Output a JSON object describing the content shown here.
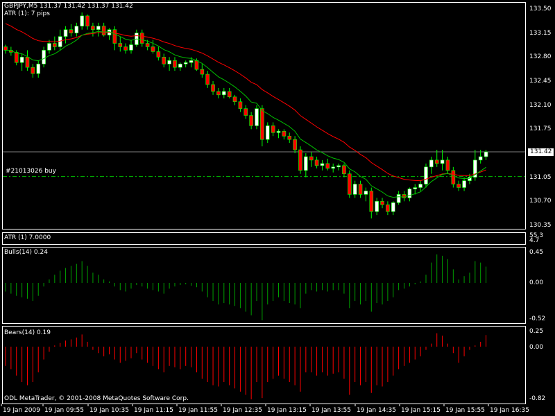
{
  "header": {
    "symbol_line": "GBPJPY,M5  131.37 131.42 131.37 131.42",
    "atr_line": "ATR (1): 7 pips"
  },
  "order": {
    "label": "#21013026 buy",
    "price": 131.06
  },
  "current_price_tag": "131.42",
  "panels": {
    "atr": {
      "label": "ATR (1) 7.0000",
      "axis": [
        "55.3",
        "4.7"
      ]
    },
    "bulls": {
      "label": "Bulls(14) 0.24",
      "axis": [
        "0.45",
        "0.00",
        "-0.52"
      ]
    },
    "bears": {
      "label": "Bears(14) 0.19",
      "axis": [
        "0.25",
        "0.00",
        "-0.82"
      ]
    }
  },
  "price_axis": [
    "133.50",
    "133.15",
    "132.80",
    "132.45",
    "132.10",
    "131.75",
    "131.05",
    "130.70",
    "130.35"
  ],
  "time_axis": [
    "19 Jan 2009",
    "19 Jan 09:55",
    "19 Jan 10:35",
    "19 Jan 11:15",
    "19 Jan 11:55",
    "19 Jan 12:35",
    "19 Jan 13:15",
    "19 Jan 13:55",
    "19 Jan 14:35",
    "19 Jan 15:15",
    "19 Jan 15:55",
    "19 Jan 16:35"
  ],
  "copyright": "ODL MetaTrader, © 2001-2008 MetaQuotes Software Corp.",
  "colors": {
    "bull": "#ffffff",
    "bear": "#ff0000",
    "wick": "#00ff00",
    "ma_slow": "#ff0000",
    "ma_fast": "#00c000",
    "bulls": "#00a000",
    "bears": "#ff0000",
    "grid_line": "#808080"
  },
  "chart_data": {
    "type": "candlestick",
    "price_range": [
      130.35,
      133.6
    ],
    "candles": [
      [
        132.95,
        132.98,
        132.85,
        132.9
      ],
      [
        132.9,
        132.95,
        132.82,
        132.87
      ],
      [
        132.87,
        132.9,
        132.68,
        132.72
      ],
      [
        132.72,
        132.85,
        132.6,
        132.8
      ],
      [
        132.8,
        132.9,
        132.6,
        132.65
      ],
      [
        132.65,
        132.7,
        132.5,
        132.56
      ],
      [
        132.56,
        132.75,
        132.5,
        132.7
      ],
      [
        132.7,
        132.95,
        132.65,
        132.9
      ],
      [
        132.9,
        133.05,
        132.85,
        133.0
      ],
      [
        133.0,
        133.1,
        132.9,
        132.95
      ],
      [
        132.95,
        133.2,
        132.9,
        133.1
      ],
      [
        133.1,
        133.25,
        133.0,
        133.2
      ],
      [
        133.2,
        133.28,
        133.1,
        133.15
      ],
      [
        133.15,
        133.3,
        133.1,
        133.25
      ],
      [
        133.25,
        133.45,
        133.2,
        133.4
      ],
      [
        133.4,
        133.42,
        133.2,
        133.25
      ],
      [
        133.25,
        133.3,
        133.1,
        133.2
      ],
      [
        133.2,
        133.3,
        133.1,
        133.25
      ],
      [
        133.25,
        133.3,
        133.1,
        133.12
      ],
      [
        133.12,
        133.22,
        133.05,
        133.2
      ],
      [
        133.2,
        133.25,
        132.9,
        133.0
      ],
      [
        133.0,
        133.1,
        132.88,
        132.95
      ],
      [
        132.95,
        133.0,
        132.85,
        132.9
      ],
      [
        132.9,
        133.05,
        132.85,
        132.98
      ],
      [
        132.98,
        133.2,
        132.95,
        133.15
      ],
      [
        133.15,
        133.2,
        132.95,
        133.0
      ],
      [
        133.0,
        133.05,
        132.9,
        132.95
      ],
      [
        132.95,
        133.05,
        132.85,
        132.88
      ],
      [
        132.88,
        132.95,
        132.75,
        132.8
      ],
      [
        132.8,
        132.85,
        132.65,
        132.7
      ],
      [
        132.7,
        132.8,
        132.6,
        132.75
      ],
      [
        132.75,
        132.8,
        132.6,
        132.65
      ],
      [
        132.65,
        132.72,
        132.6,
        132.7
      ],
      [
        132.7,
        132.75,
        132.65,
        132.72
      ],
      [
        132.72,
        132.8,
        132.65,
        132.75
      ],
      [
        132.75,
        132.78,
        132.6,
        132.62
      ],
      [
        132.62,
        132.7,
        132.5,
        132.55
      ],
      [
        132.55,
        132.6,
        132.35,
        132.4
      ],
      [
        132.4,
        132.45,
        132.25,
        132.3
      ],
      [
        132.3,
        132.35,
        132.2,
        132.25
      ],
      [
        132.25,
        132.35,
        132.2,
        132.3
      ],
      [
        132.3,
        132.35,
        132.2,
        132.22
      ],
      [
        132.22,
        132.25,
        132.1,
        132.15
      ],
      [
        132.15,
        132.2,
        132.0,
        132.05
      ],
      [
        132.05,
        132.1,
        131.9,
        131.95
      ],
      [
        131.95,
        132.0,
        131.75,
        131.8
      ],
      [
        131.8,
        132.1,
        131.75,
        132.05
      ],
      [
        132.05,
        132.1,
        131.5,
        131.6
      ],
      [
        131.6,
        131.85,
        131.55,
        131.8
      ],
      [
        131.8,
        131.85,
        131.65,
        131.7
      ],
      [
        131.7,
        131.75,
        131.62,
        131.72
      ],
      [
        131.72,
        131.75,
        131.6,
        131.65
      ],
      [
        131.65,
        131.7,
        131.55,
        131.6
      ],
      [
        131.6,
        131.65,
        131.4,
        131.45
      ],
      [
        131.45,
        131.5,
        131.1,
        131.15
      ],
      [
        131.15,
        131.4,
        131.05,
        131.35
      ],
      [
        131.35,
        131.42,
        131.2,
        131.3
      ],
      [
        131.3,
        131.35,
        131.18,
        131.22
      ],
      [
        131.22,
        131.3,
        131.15,
        131.25
      ],
      [
        131.25,
        131.32,
        131.15,
        131.18
      ],
      [
        131.18,
        131.25,
        131.12,
        131.2
      ],
      [
        131.2,
        131.25,
        131.15,
        131.22
      ],
      [
        131.22,
        131.25,
        131.05,
        131.1
      ],
      [
        131.1,
        131.15,
        130.75,
        130.8
      ],
      [
        130.8,
        131.0,
        130.75,
        130.95
      ],
      [
        130.95,
        131.0,
        130.75,
        130.8
      ],
      [
        130.8,
        130.9,
        130.7,
        130.85
      ],
      [
        130.85,
        130.9,
        130.45,
        130.55
      ],
      [
        130.55,
        130.75,
        130.5,
        130.7
      ],
      [
        130.7,
        130.75,
        130.6,
        130.65
      ],
      [
        130.65,
        130.7,
        130.5,
        130.55
      ],
      [
        130.55,
        130.7,
        130.5,
        130.68
      ],
      [
        130.68,
        130.85,
        130.65,
        130.8
      ],
      [
        130.8,
        130.85,
        130.7,
        130.75
      ],
      [
        130.75,
        130.9,
        130.7,
        130.88
      ],
      [
        130.88,
        130.95,
        130.8,
        130.9
      ],
      [
        130.9,
        131.0,
        130.85,
        130.95
      ],
      [
        130.95,
        131.25,
        130.9,
        131.2
      ],
      [
        131.2,
        131.35,
        131.1,
        131.3
      ],
      [
        131.3,
        131.45,
        131.2,
        131.25
      ],
      [
        131.25,
        131.45,
        131.15,
        131.3
      ],
      [
        131.3,
        131.35,
        131.1,
        131.15
      ],
      [
        131.15,
        131.2,
        130.9,
        130.95
      ],
      [
        130.95,
        131.0,
        130.85,
        130.9
      ],
      [
        130.9,
        131.05,
        130.85,
        131.0
      ],
      [
        131.0,
        131.1,
        130.95,
        131.05
      ],
      [
        131.05,
        131.45,
        131.0,
        131.3
      ],
      [
        131.3,
        131.45,
        131.25,
        131.35
      ],
      [
        131.35,
        131.45,
        131.3,
        131.42
      ]
    ],
    "bulls_values": [
      -0.12,
      -0.15,
      -0.18,
      -0.2,
      -0.22,
      -0.25,
      -0.18,
      -0.05,
      0.05,
      0.12,
      0.18,
      0.22,
      0.25,
      0.28,
      0.32,
      0.25,
      0.15,
      0.12,
      0.05,
      0.02,
      -0.05,
      -0.1,
      -0.12,
      -0.08,
      -0.03,
      -0.05,
      -0.08,
      -0.1,
      -0.12,
      -0.15,
      -0.08,
      -0.05,
      -0.03,
      -0.02,
      -0.04,
      -0.06,
      -0.12,
      -0.2,
      -0.25,
      -0.3,
      -0.28,
      -0.3,
      -0.32,
      -0.35,
      -0.4,
      -0.45,
      -0.25,
      -0.52,
      -0.3,
      -0.25,
      -0.2,
      -0.25,
      -0.28,
      -0.3,
      -0.35,
      -0.15,
      -0.1,
      -0.12,
      -0.1,
      -0.12,
      -0.1,
      -0.1,
      -0.15,
      -0.35,
      -0.25,
      -0.3,
      -0.25,
      -0.4,
      -0.28,
      -0.3,
      -0.25,
      -0.2,
      -0.1,
      -0.08,
      -0.05,
      -0.02,
      0.02,
      0.12,
      0.3,
      0.42,
      0.4,
      0.35,
      0.2,
      0.05,
      0.1,
      0.15,
      0.32,
      0.3,
      0.24
    ],
    "bears_values": [
      -0.3,
      -0.35,
      -0.45,
      -0.55,
      -0.6,
      -0.55,
      -0.4,
      -0.2,
      -0.08,
      0.02,
      0.06,
      0.1,
      0.12,
      0.15,
      0.2,
      0.08,
      -0.05,
      -0.1,
      -0.15,
      -0.12,
      -0.2,
      -0.25,
      -0.22,
      -0.18,
      -0.1,
      -0.2,
      -0.25,
      -0.3,
      -0.35,
      -0.4,
      -0.3,
      -0.32,
      -0.35,
      -0.3,
      -0.32,
      -0.4,
      -0.5,
      -0.55,
      -0.6,
      -0.62,
      -0.55,
      -0.6,
      -0.65,
      -0.7,
      -0.75,
      -0.82,
      -0.55,
      -0.8,
      -0.55,
      -0.5,
      -0.45,
      -0.5,
      -0.55,
      -0.6,
      -0.7,
      -0.4,
      -0.4,
      -0.45,
      -0.4,
      -0.45,
      -0.42,
      -0.4,
      -0.5,
      -0.75,
      -0.55,
      -0.6,
      -0.55,
      -0.72,
      -0.6,
      -0.62,
      -0.55,
      -0.45,
      -0.35,
      -0.3,
      -0.25,
      -0.2,
      -0.15,
      -0.05,
      0.05,
      0.22,
      0.18,
      0.05,
      -0.1,
      -0.25,
      -0.15,
      -0.05,
      0.02,
      0.08,
      0.19
    ]
  }
}
